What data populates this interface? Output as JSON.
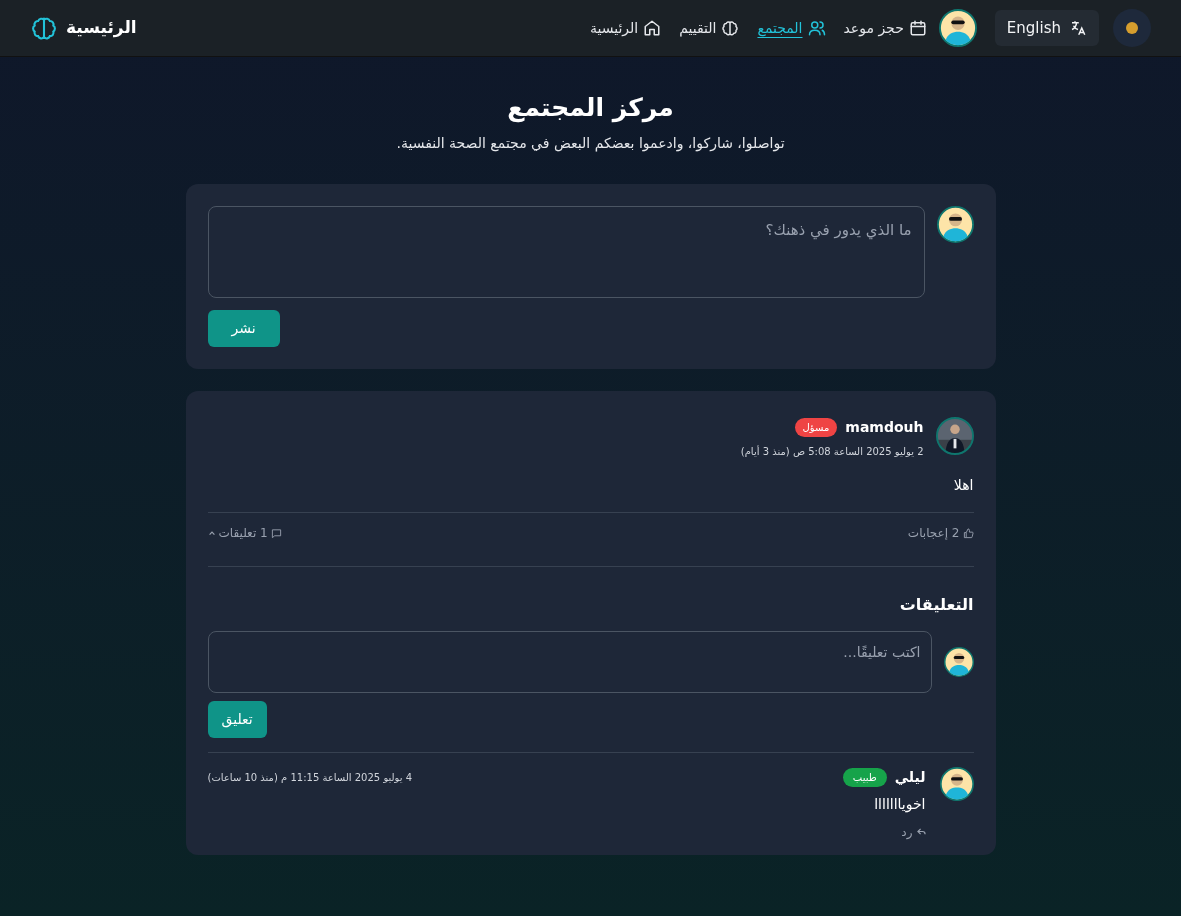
{
  "nav": {
    "brand": "الرئيسية",
    "links": [
      {
        "label": "حجز موعد",
        "kind": "calendar",
        "selected": false
      },
      {
        "label": "المجتمع",
        "kind": "users",
        "selected": true
      },
      {
        "label": "التقييم",
        "kind": "brain",
        "selected": false
      },
      {
        "label": "الرئيسية",
        "kind": "home",
        "selected": false
      }
    ],
    "language": "English"
  },
  "header": {
    "title": "مركز المجتمع",
    "subtitle": "تواصلوا، شاركوا، وادعموا بعضكم البعض في مجتمع الصحة النفسية."
  },
  "composer": {
    "placeholder": "ما الذي يدور في ذهنك؟",
    "button": "نشر"
  },
  "posts": [
    {
      "author": "mamdouh",
      "badge": {
        "label": "مسؤل",
        "color": "#ef4444"
      },
      "time": "2 يوليو 2025 الساعة 5:08 ص (منذ 3 أيام)",
      "body": "اهلا",
      "likes": "2 إعجابات",
      "comments_toggle": "1 تعليقات",
      "expanded": true,
      "comments_section": {
        "title": "التعليقات",
        "placeholder": "اكتب تعليقًا...",
        "button": "تعليق"
      },
      "comments": [
        {
          "author": "ليلي",
          "badge": {
            "label": "طبيب",
            "color": "#16a34a"
          },
          "time": "4 يوليو 2025 الساعة 11:15 م (منذ 10 ساعات)",
          "body": "اخويااااااا",
          "reply": "رد"
        }
      ]
    }
  ]
}
